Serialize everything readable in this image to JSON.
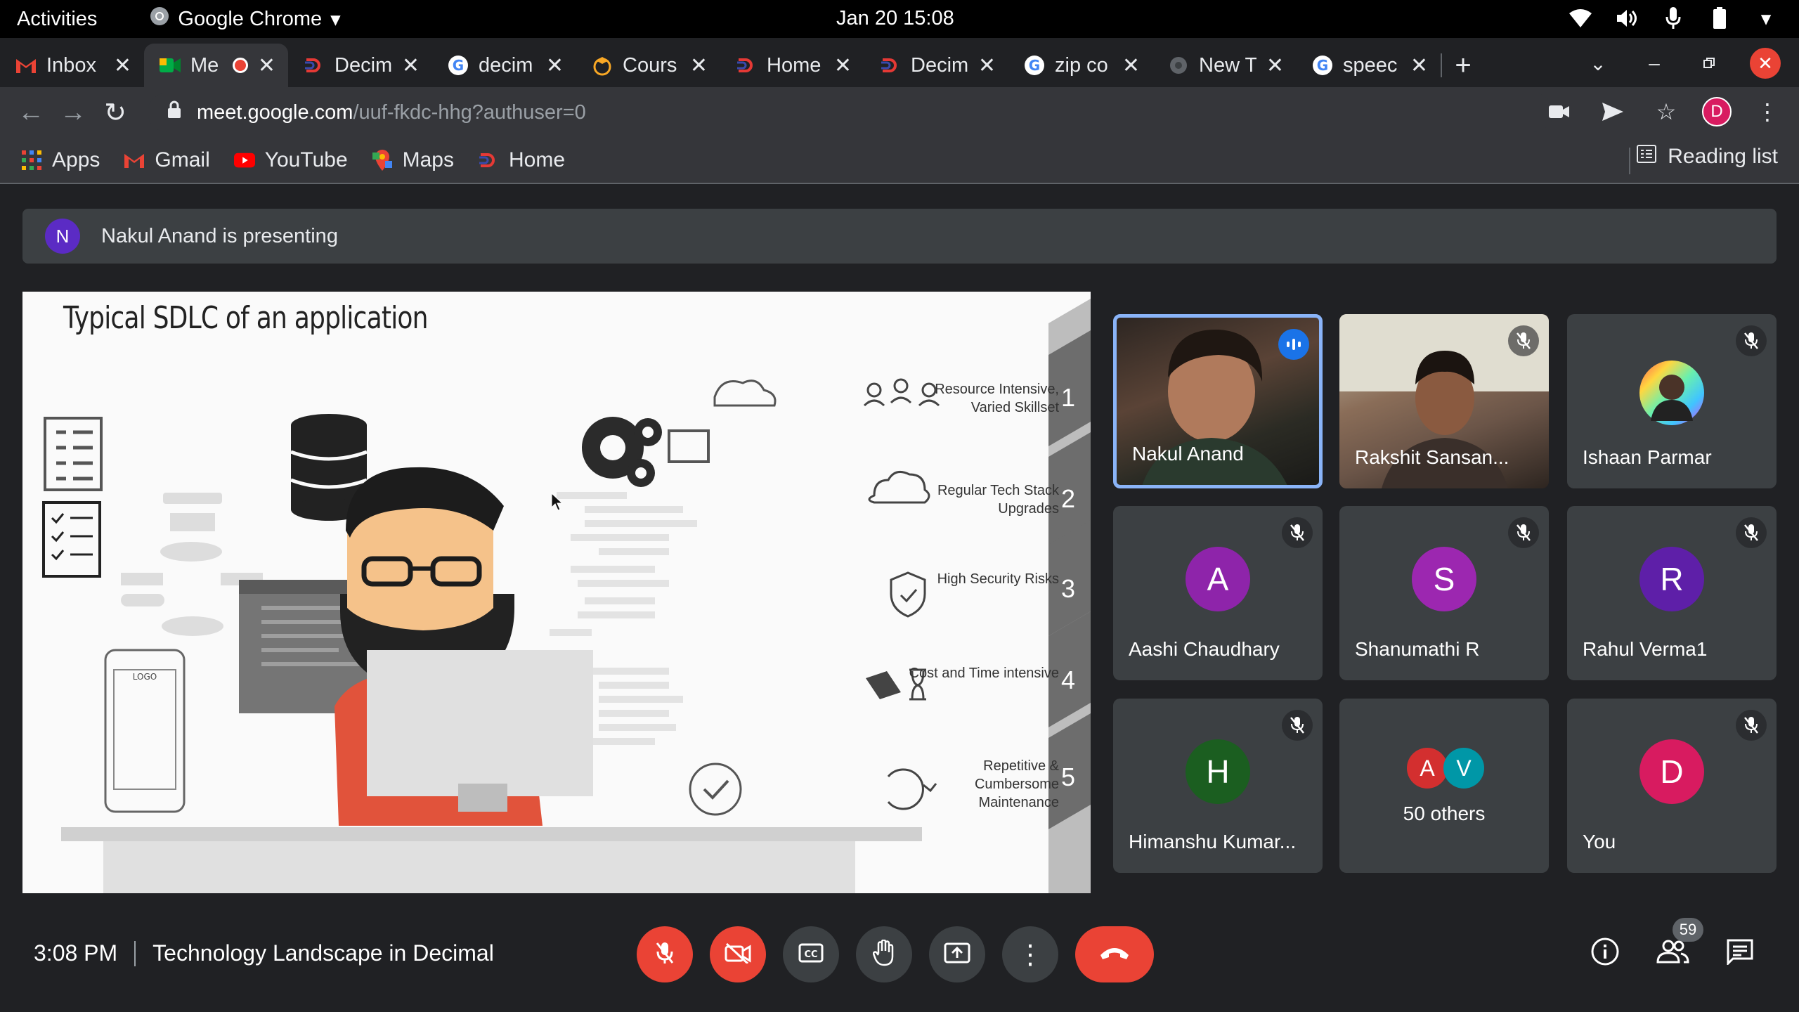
{
  "os": {
    "activities": "Activities",
    "app_name": "Google Chrome",
    "clock": "Jan 20  15:08"
  },
  "tabs": [
    {
      "title": "Inbox",
      "icon": "gmail-icon"
    },
    {
      "title": "Me",
      "icon": "meet-icon",
      "active": true,
      "recording": true
    },
    {
      "title": "Decim",
      "icon": "decimal-icon"
    },
    {
      "title": "decim",
      "icon": "google-icon"
    },
    {
      "title": "Cours",
      "icon": "course-icon"
    },
    {
      "title": "Home",
      "icon": "decimal-icon"
    },
    {
      "title": "Decim",
      "icon": "decimal-icon"
    },
    {
      "title": "zip co",
      "icon": "google-icon"
    },
    {
      "title": "New T",
      "icon": "newtab-icon"
    },
    {
      "title": "speec",
      "icon": "google-icon"
    }
  ],
  "address": {
    "host": "meet.google.com",
    "path": "/uuf-fkdc-hhg?authuser=0"
  },
  "profile_initial": "D",
  "bookmarks": [
    {
      "label": "Apps",
      "icon": "apps-grid-icon"
    },
    {
      "label": "Gmail",
      "icon": "gmail-icon"
    },
    {
      "label": "YouTube",
      "icon": "youtube-icon"
    },
    {
      "label": "Maps",
      "icon": "maps-icon"
    },
    {
      "label": "Home",
      "icon": "decimal-icon"
    }
  ],
  "reading_list": "Reading list",
  "presenting": {
    "initial": "N",
    "text": "Nakul Anand is presenting"
  },
  "slide": {
    "title": "Typical SDLC of an application",
    "steps": [
      {
        "num": "1",
        "text": "Resource Intensive, Varied Skillset"
      },
      {
        "num": "2",
        "text": "Regular Tech Stack Upgrades"
      },
      {
        "num": "3",
        "text": "High Security Risks"
      },
      {
        "num": "4",
        "text": "Cost and Time intensive"
      },
      {
        "num": "5",
        "text": "Repetitive & Cumbersome Maintenance"
      }
    ]
  },
  "participants": [
    {
      "name": "Nakul Anand",
      "type": "video",
      "speaking": true
    },
    {
      "name": "Rakshit Sansan...",
      "type": "video",
      "muted": true
    },
    {
      "name": "Ishaan Parmar",
      "type": "photo",
      "muted": true
    },
    {
      "name": "Aashi Chaudhary",
      "initial": "A",
      "color": "#8e24aa",
      "muted": true
    },
    {
      "name": "Shanumathi R",
      "initial": "S",
      "color": "#9c27b0",
      "muted": true
    },
    {
      "name": "Rahul Verma1",
      "initial": "R",
      "color": "#5e1fa8",
      "muted": true
    },
    {
      "name": "Himanshu Kumar...",
      "initial": "H",
      "color": "#1b5e20",
      "muted": true
    },
    {
      "name": "50 others",
      "type": "others",
      "initials": [
        "A",
        "V"
      ],
      "colors": [
        "#d32f2f",
        "#0097a7"
      ]
    },
    {
      "name": "You",
      "initial": "D",
      "color": "#d81b60",
      "muted": true
    }
  ],
  "meeting": {
    "time": "3:08 PM",
    "title": "Technology Landscape in Decimal",
    "people_count": "59"
  }
}
